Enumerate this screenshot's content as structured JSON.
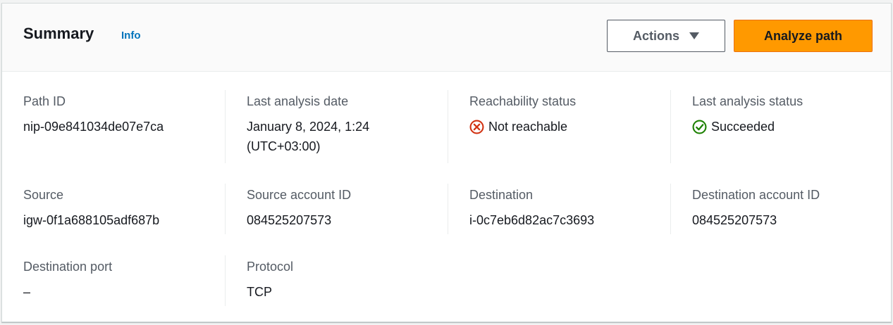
{
  "header": {
    "title": "Summary",
    "info": "Info",
    "actions_label": "Actions",
    "analyze_label": "Analyze path"
  },
  "fields": {
    "path_id": {
      "label": "Path ID",
      "value": "nip-09e841034de07e7ca"
    },
    "last_analysis_date": {
      "label": "Last analysis date",
      "value_line1": "January 8, 2024, 1:24",
      "value_line2": "(UTC+03:00)"
    },
    "reachability_status": {
      "label": "Reachability status",
      "value": "Not reachable",
      "icon": "x-circle-icon",
      "color": "#d13212"
    },
    "last_analysis_status": {
      "label": "Last analysis status",
      "value": "Succeeded",
      "icon": "check-circle-icon",
      "color": "#1d8102"
    },
    "source": {
      "label": "Source",
      "value": "igw-0f1a688105adf687b"
    },
    "source_account_id": {
      "label": "Source account ID",
      "value": "084525207573"
    },
    "destination": {
      "label": "Destination",
      "value": "i-0c7eb6d82ac7c3693"
    },
    "destination_account_id": {
      "label": "Destination account ID",
      "value": "084525207573"
    },
    "destination_port": {
      "label": "Destination port",
      "value": "–"
    },
    "protocol": {
      "label": "Protocol",
      "value": "TCP"
    }
  },
  "colors": {
    "primary_button": "#ff9900",
    "link": "#0073bb",
    "error": "#d13212",
    "success": "#1d8102"
  }
}
